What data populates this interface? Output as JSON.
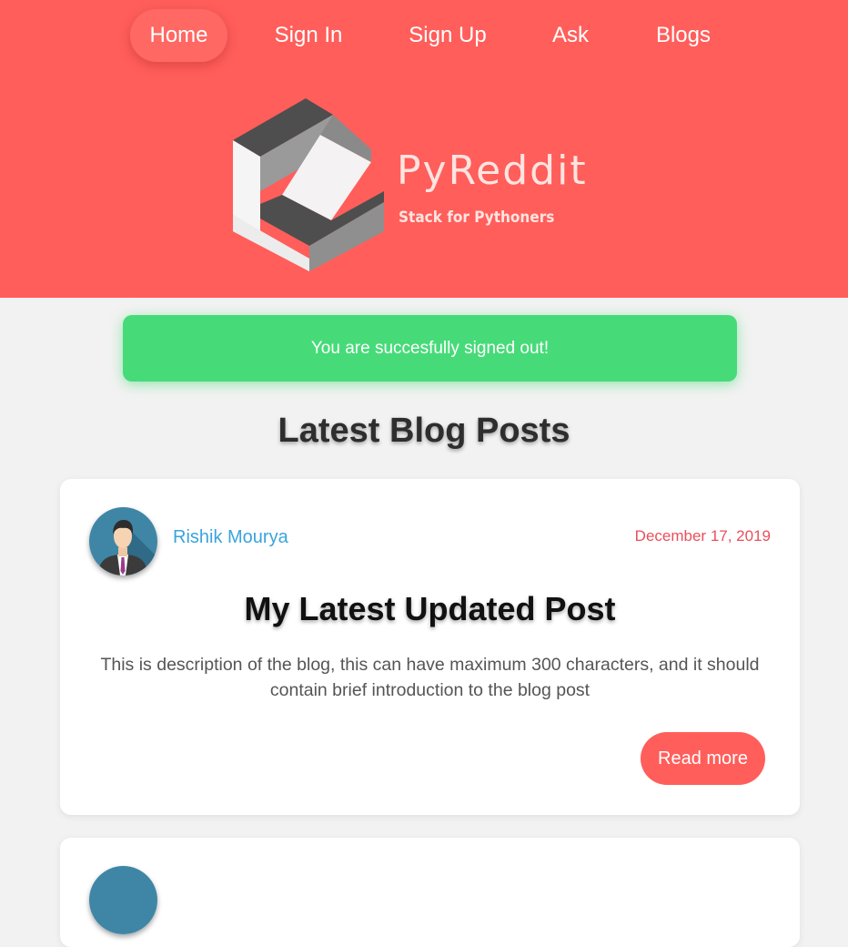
{
  "nav": {
    "items": [
      {
        "label": "Home"
      },
      {
        "label": "Sign In"
      },
      {
        "label": "Sign Up"
      },
      {
        "label": "Ask"
      },
      {
        "label": "Blogs"
      }
    ]
  },
  "brand": {
    "name": "PyReddit",
    "tagline": "Stack for Pythoners"
  },
  "alert": {
    "message": "You are succesfully signed out!"
  },
  "section": {
    "title": "Latest Blog Posts"
  },
  "posts": [
    {
      "author": "Rishik Mourya",
      "date": "December 17, 2019",
      "title": "My Latest Updated Post",
      "description": "This is description of the blog, this can have maximum 300 characters, and it should contain brief introduction to the blog post",
      "read_more_label": "Read more"
    }
  ],
  "colors": {
    "header": "#ff5e5b",
    "alert": "#46db78",
    "author_link": "#3aa4dc",
    "date": "#e8505b"
  }
}
